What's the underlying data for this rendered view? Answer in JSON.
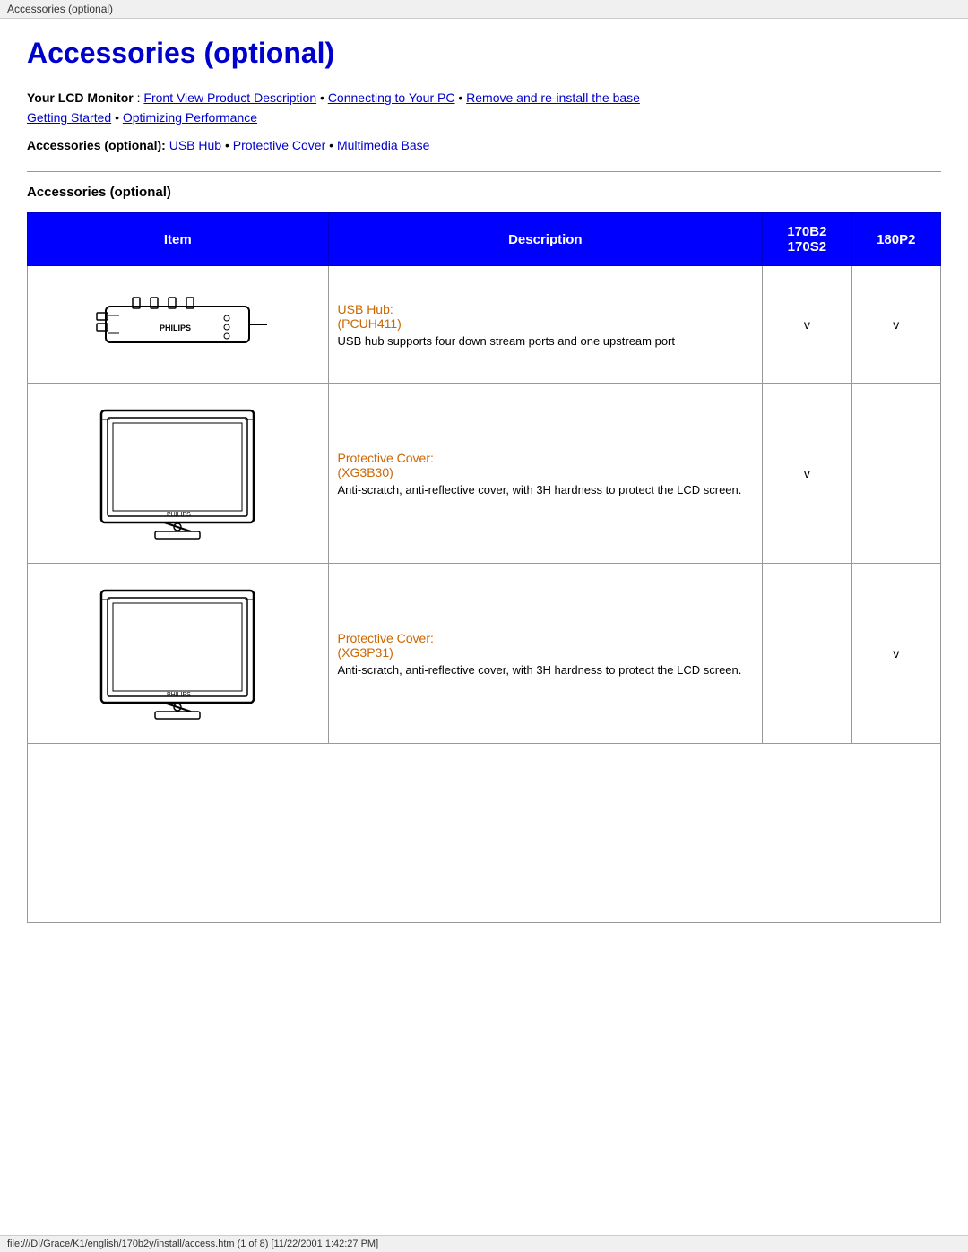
{
  "browser_bar": {
    "url_bar_text": "Accessories (optional)"
  },
  "page": {
    "title": "Accessories (optional)",
    "nav": {
      "intro": "Your LCD Monitor",
      "separator": ":",
      "links": [
        {
          "label": "Front View Product Description",
          "href": "#"
        },
        {
          "label": "Connecting to Your PC",
          "href": "#"
        },
        {
          "label": "Remove and re-install the base",
          "href": "#"
        },
        {
          "label": "Getting Started",
          "href": "#"
        },
        {
          "label": "Optimizing Performance",
          "href": "#"
        }
      ],
      "accessories_label": "Accessories (optional):",
      "accessory_links": [
        {
          "label": "USB Hub",
          "href": "#"
        },
        {
          "label": "Protective Cover",
          "href": "#"
        },
        {
          "label": "Multimedia Base",
          "href": "#"
        }
      ]
    },
    "section_heading": "Accessories (optional)",
    "table": {
      "headers": {
        "item": "Item",
        "description": "Description",
        "col170": "170B2\n170S2",
        "col180": "180P2"
      },
      "rows": [
        {
          "desc_title": "USB Hub:",
          "desc_model": "(PCUH411)",
          "desc_text": "USB hub supports four down stream ports and one upstream port",
          "check_170": "v",
          "check_180": "v"
        },
        {
          "desc_title": "Protective Cover:",
          "desc_model": "(XG3B30)",
          "desc_text": "Anti-scratch, anti-reflective cover, with 3H hardness to protect the LCD screen.",
          "check_170": "v",
          "check_180": ""
        },
        {
          "desc_title": "Protective Cover:",
          "desc_model": "(XG3P31)",
          "desc_text": "Anti-scratch, anti-reflective cover, with 3H hardness to protect the LCD screen.",
          "check_170": "",
          "check_180": "v"
        }
      ]
    }
  },
  "status_bar": {
    "text": "file:///D|/Grace/K1/english/170b2y/install/access.htm (1 of 8) [11/22/2001 1:42:27 PM]"
  }
}
